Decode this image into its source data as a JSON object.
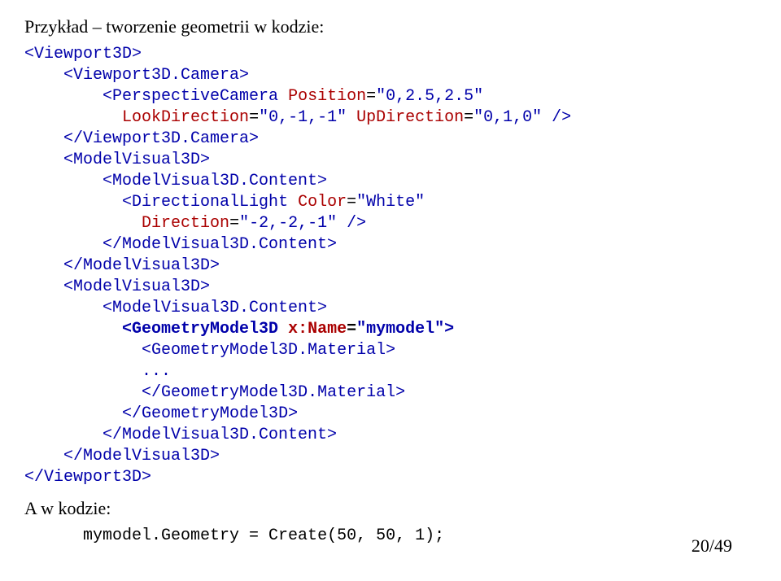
{
  "heading": "Przykład – tworzenie geometrii w kodzie:",
  "code": {
    "l1": "<Viewport3D>",
    "l2_open": "<Viewport3D.Camera>",
    "l3a_open": "<PerspectiveCamera",
    "l3a_attr1": " Position",
    "l3a_eq1": "=",
    "l3a_val1": "\"0,2.5,2.5\"",
    "l3b_indent": "          ",
    "l3b_attr1": "LookDirection",
    "l3b_eq1": "=",
    "l3b_val1": "\"0,-1,-1\"",
    "l3b_attr2": " UpDirection",
    "l3b_eq2": "=",
    "l3b_val2": "\"0,1,0\"",
    "l3b_close": " />",
    "l4": "</Viewport3D.Camera>",
    "l5": "<ModelVisual3D>",
    "l6": "<ModelVisual3D.Content>",
    "l7a_open": "<DirectionalLight",
    "l7a_attr1": " Color",
    "l7a_eq1": "=",
    "l7a_val1": "\"White\"",
    "l7b_indent": "            ",
    "l7b_attr1": "Direction",
    "l7b_eq1": "=",
    "l7b_val1": "\"-2,-2,-1\"",
    "l7b_close": " />",
    "l8": "</ModelVisual3D.Content>",
    "l9": "</ModelVisual3D>",
    "l10": "<ModelVisual3D>",
    "l11": "<ModelVisual3D.Content>",
    "l12a_open": "<GeometryModel3D",
    "l12a_attr1": " x:Name",
    "l12a_eq1": "=",
    "l12a_val1": "\"mymodel\"",
    "l12a_close": ">",
    "l13": "<GeometryModel3D.Material>",
    "l14": "...",
    "l15": "</GeometryModel3D.Material>",
    "l16": "</GeometryModel3D>",
    "l17": "</ModelVisual3D.Content>",
    "l18": "</ModelVisual3D>",
    "l19": "</Viewport3D>"
  },
  "subheading": "A w kodzie:",
  "inline": "mymodel.Geometry = Create(50, 50, 1);",
  "pagenum": "20/49"
}
